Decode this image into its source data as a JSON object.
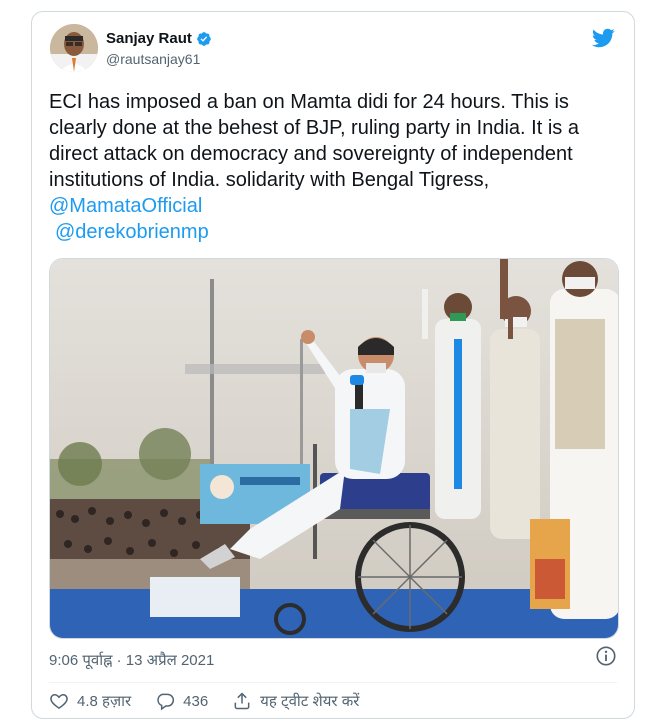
{
  "tweet": {
    "author": {
      "name": "Sanjay Raut",
      "handle": "@rautsanjay61"
    },
    "text_lines": [
      "ECI has imposed a ban on Mamta didi for 24 hours. This is",
      "clearly done at the behest of BJP, ruling party in India. It is a",
      "direct attack on democracy and sovereignty of independent",
      "institutions of India. solidarity with Bengal Tigress,"
    ],
    "mentions": [
      "@MamataOfficial",
      "@derekobrienmp"
    ],
    "timestamp": "9:06 पूर्वाह्न · 13 अप्रैल 2021",
    "actions": {
      "likes": "4.8 हज़ार",
      "replies": "436",
      "share": "यह ट्वीट शेयर करें"
    }
  },
  "icons": {
    "verified": "verified-badge-icon",
    "brand": "twitter-bird-icon",
    "info": "info-icon",
    "like": "heart-icon",
    "reply": "reply-bubble-icon",
    "share": "share-upload-icon"
  },
  "colors": {
    "accent": "#1d9bf0",
    "text": "#0f1419",
    "muted": "#536471",
    "border": "#cfd9de"
  }
}
